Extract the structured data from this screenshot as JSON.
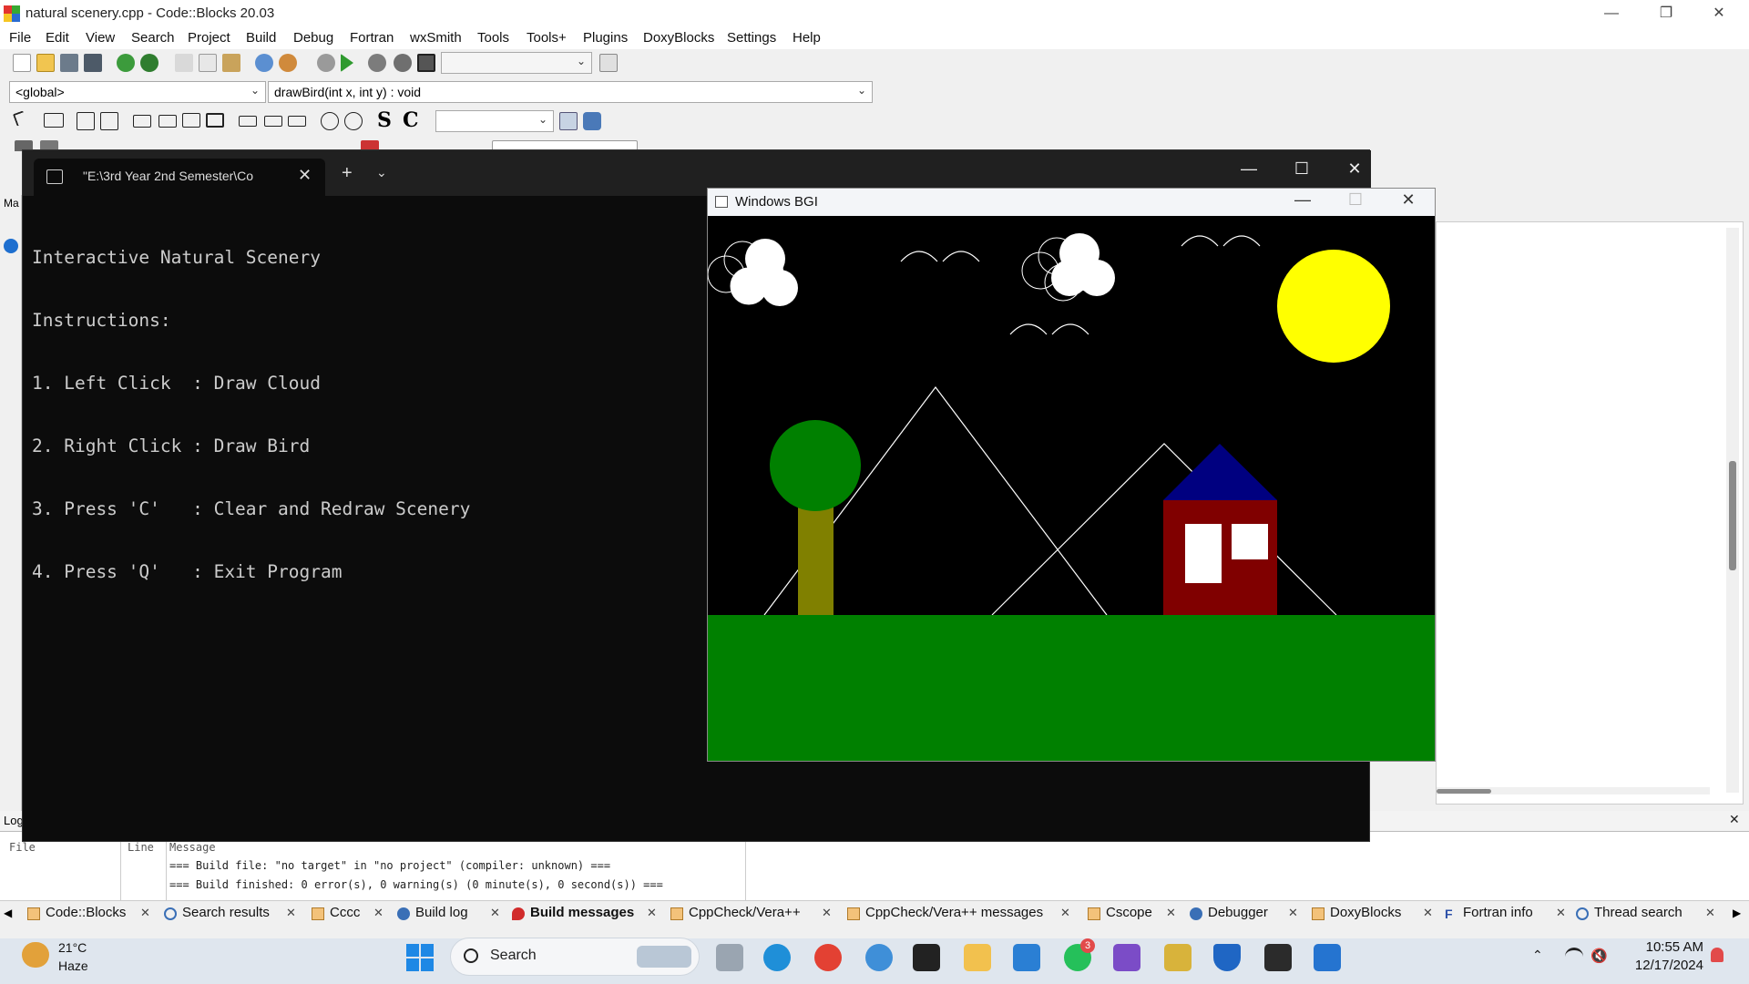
{
  "app": {
    "window_title": "natural scenery.cpp - Code::Blocks 20.03",
    "menu": [
      "File",
      "Edit",
      "View",
      "Search",
      "Project",
      "Build",
      "Debug",
      "Fortran",
      "wxSmith",
      "Tools",
      "Tools+",
      "Plugins",
      "DoxyBlocks",
      "Settings",
      "Help"
    ],
    "scope_combo": "<global>",
    "function_combo": "drawBird(int x, int y) : void",
    "left_panel_label": "Ma",
    "logs_label": "Log"
  },
  "terminal": {
    "tab_title": "\"E:\\3rd Year 2nd Semester\\Co",
    "lines": [
      "Interactive Natural Scenery",
      "Instructions:",
      "1. Left Click  : Draw Cloud",
      "2. Right Click : Draw Bird",
      "3. Press 'C'   : Clear and Redraw Scenery",
      "4. Press 'Q'   : Exit Program"
    ]
  },
  "bgi": {
    "window_title": "Windows BGI",
    "colors": {
      "sky": "#000000",
      "ground": "#008000",
      "sun": "#ffff00",
      "tree_foliage": "#008000",
      "tree_trunk": "#808000",
      "house_wall": "#800000",
      "house_roof": "#000080",
      "window": "#ffffff",
      "line": "#ffffff"
    }
  },
  "build_log": {
    "columns": [
      "File",
      "Line",
      "Message"
    ],
    "messages": [
      "=== Build file: \"no target\" in \"no project\" (compiler: unknown) ===",
      "=== Build finished: 0 error(s), 0 warning(s) (0 minute(s), 0 second(s)) ==="
    ]
  },
  "bottom_tabs": [
    {
      "label": "Code::Blocks",
      "icon": "document-icon"
    },
    {
      "label": "Search results",
      "icon": "search-icon"
    },
    {
      "label": "Cccc",
      "icon": "document-icon"
    },
    {
      "label": "Build log",
      "icon": "gear-icon"
    },
    {
      "label": "Build messages",
      "icon": "pin-icon",
      "active": true
    },
    {
      "label": "CppCheck/Vera++",
      "icon": "document-icon"
    },
    {
      "label": "CppCheck/Vera++ messages",
      "icon": "document-icon"
    },
    {
      "label": "Cscope",
      "icon": "document-icon"
    },
    {
      "label": "Debugger",
      "icon": "gear-icon"
    },
    {
      "label": "DoxyBlocks",
      "icon": "document-icon"
    },
    {
      "label": "Fortran info",
      "icon": "fortran-icon"
    },
    {
      "label": "Thread search",
      "icon": "search-icon"
    }
  ],
  "taskbar": {
    "weather_temp": "21°C",
    "weather_desc": "Haze",
    "search_label": "Search",
    "whatsapp_badge": "3",
    "time": "10:55 AM",
    "date": "12/17/2024"
  }
}
